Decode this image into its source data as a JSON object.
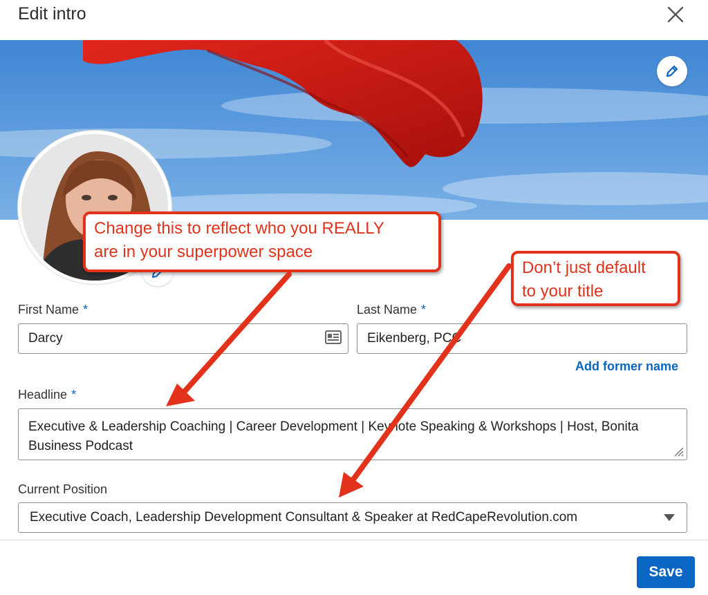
{
  "dialog": {
    "title": "Edit intro"
  },
  "form": {
    "first_name_label": "First Name",
    "first_name_value": "Darcy",
    "last_name_label": "Last Name",
    "last_name_value": "Eikenberg, PCC",
    "required_mark": "*",
    "add_former_name": "Add former name",
    "headline_label": "Headline",
    "headline_value": "Executive & Leadership Coaching | Career Development | Keynote Speaking & Workshops | Host, Bonita Business Podcast",
    "position_label": "Current Position",
    "position_value": "Executive Coach, Leadership Development Consultant & Speaker at RedCapeRevolution.com"
  },
  "actions": {
    "save_label": "Save"
  },
  "annotations": {
    "callout_headline": [
      "Change this to reflect who you REALLY",
      "are in your superpower space"
    ],
    "callout_title": [
      "Don’t just default",
      "to your title"
    ]
  },
  "colors": {
    "accent": "#0a66c2",
    "annotation": "#e2321c"
  },
  "icons": [
    "close-icon",
    "pencil-icon",
    "contact-card-icon",
    "resize-grip-icon",
    "caret-down-icon"
  ]
}
